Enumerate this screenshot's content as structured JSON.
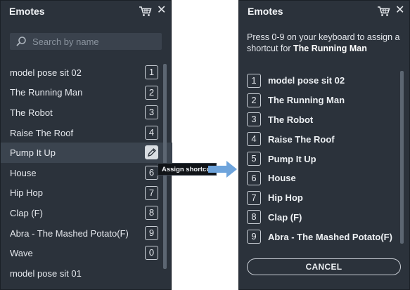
{
  "left_panel": {
    "title": "Emotes",
    "search_placeholder": "Search by name",
    "items": [
      {
        "name": "model pose sit 02",
        "key": "1"
      },
      {
        "name": "The Running Man",
        "key": "2"
      },
      {
        "name": "The Robot",
        "key": "3"
      },
      {
        "name": "Raise The Roof",
        "key": "4"
      },
      {
        "name": "Pump It Up",
        "key": ""
      },
      {
        "name": "House",
        "key": "6"
      },
      {
        "name": "Hip Hop",
        "key": "7"
      },
      {
        "name": "Clap (F)",
        "key": "8"
      },
      {
        "name": "Abra - The Mashed Potato(F)",
        "key": "9"
      },
      {
        "name": "Wave",
        "key": "0"
      },
      {
        "name": "model pose sit 01",
        "key": ""
      }
    ],
    "hovered_index": 4,
    "tooltip": "Assign shortcut"
  },
  "right_panel": {
    "title": "Emotes",
    "instruction_prefix": "Press 0-9 on your keyboard to assign a shortcut for ",
    "instruction_target": "The Running Man",
    "items": [
      {
        "key": "1",
        "name": "model pose sit 02"
      },
      {
        "key": "2",
        "name": "The Running Man"
      },
      {
        "key": "3",
        "name": "The Robot"
      },
      {
        "key": "4",
        "name": "Raise The Roof"
      },
      {
        "key": "5",
        "name": "Pump It Up"
      },
      {
        "key": "6",
        "name": "House"
      },
      {
        "key": "7",
        "name": "Hip Hop"
      },
      {
        "key": "8",
        "name": "Clap (F)"
      },
      {
        "key": "9",
        "name": "Abra - The Mashed Potato(F)"
      }
    ],
    "cancel_label": "CANCEL"
  },
  "icons": {
    "cart": "shopping-cart-icon",
    "close": "close-icon",
    "search": "search-icon",
    "edit": "pencil-icon",
    "arrow": "right-arrow-icon"
  },
  "colors": {
    "panel_bg": "#2b323b",
    "arrow": "#6ea4dc",
    "tooltip_bg": "#111418"
  }
}
